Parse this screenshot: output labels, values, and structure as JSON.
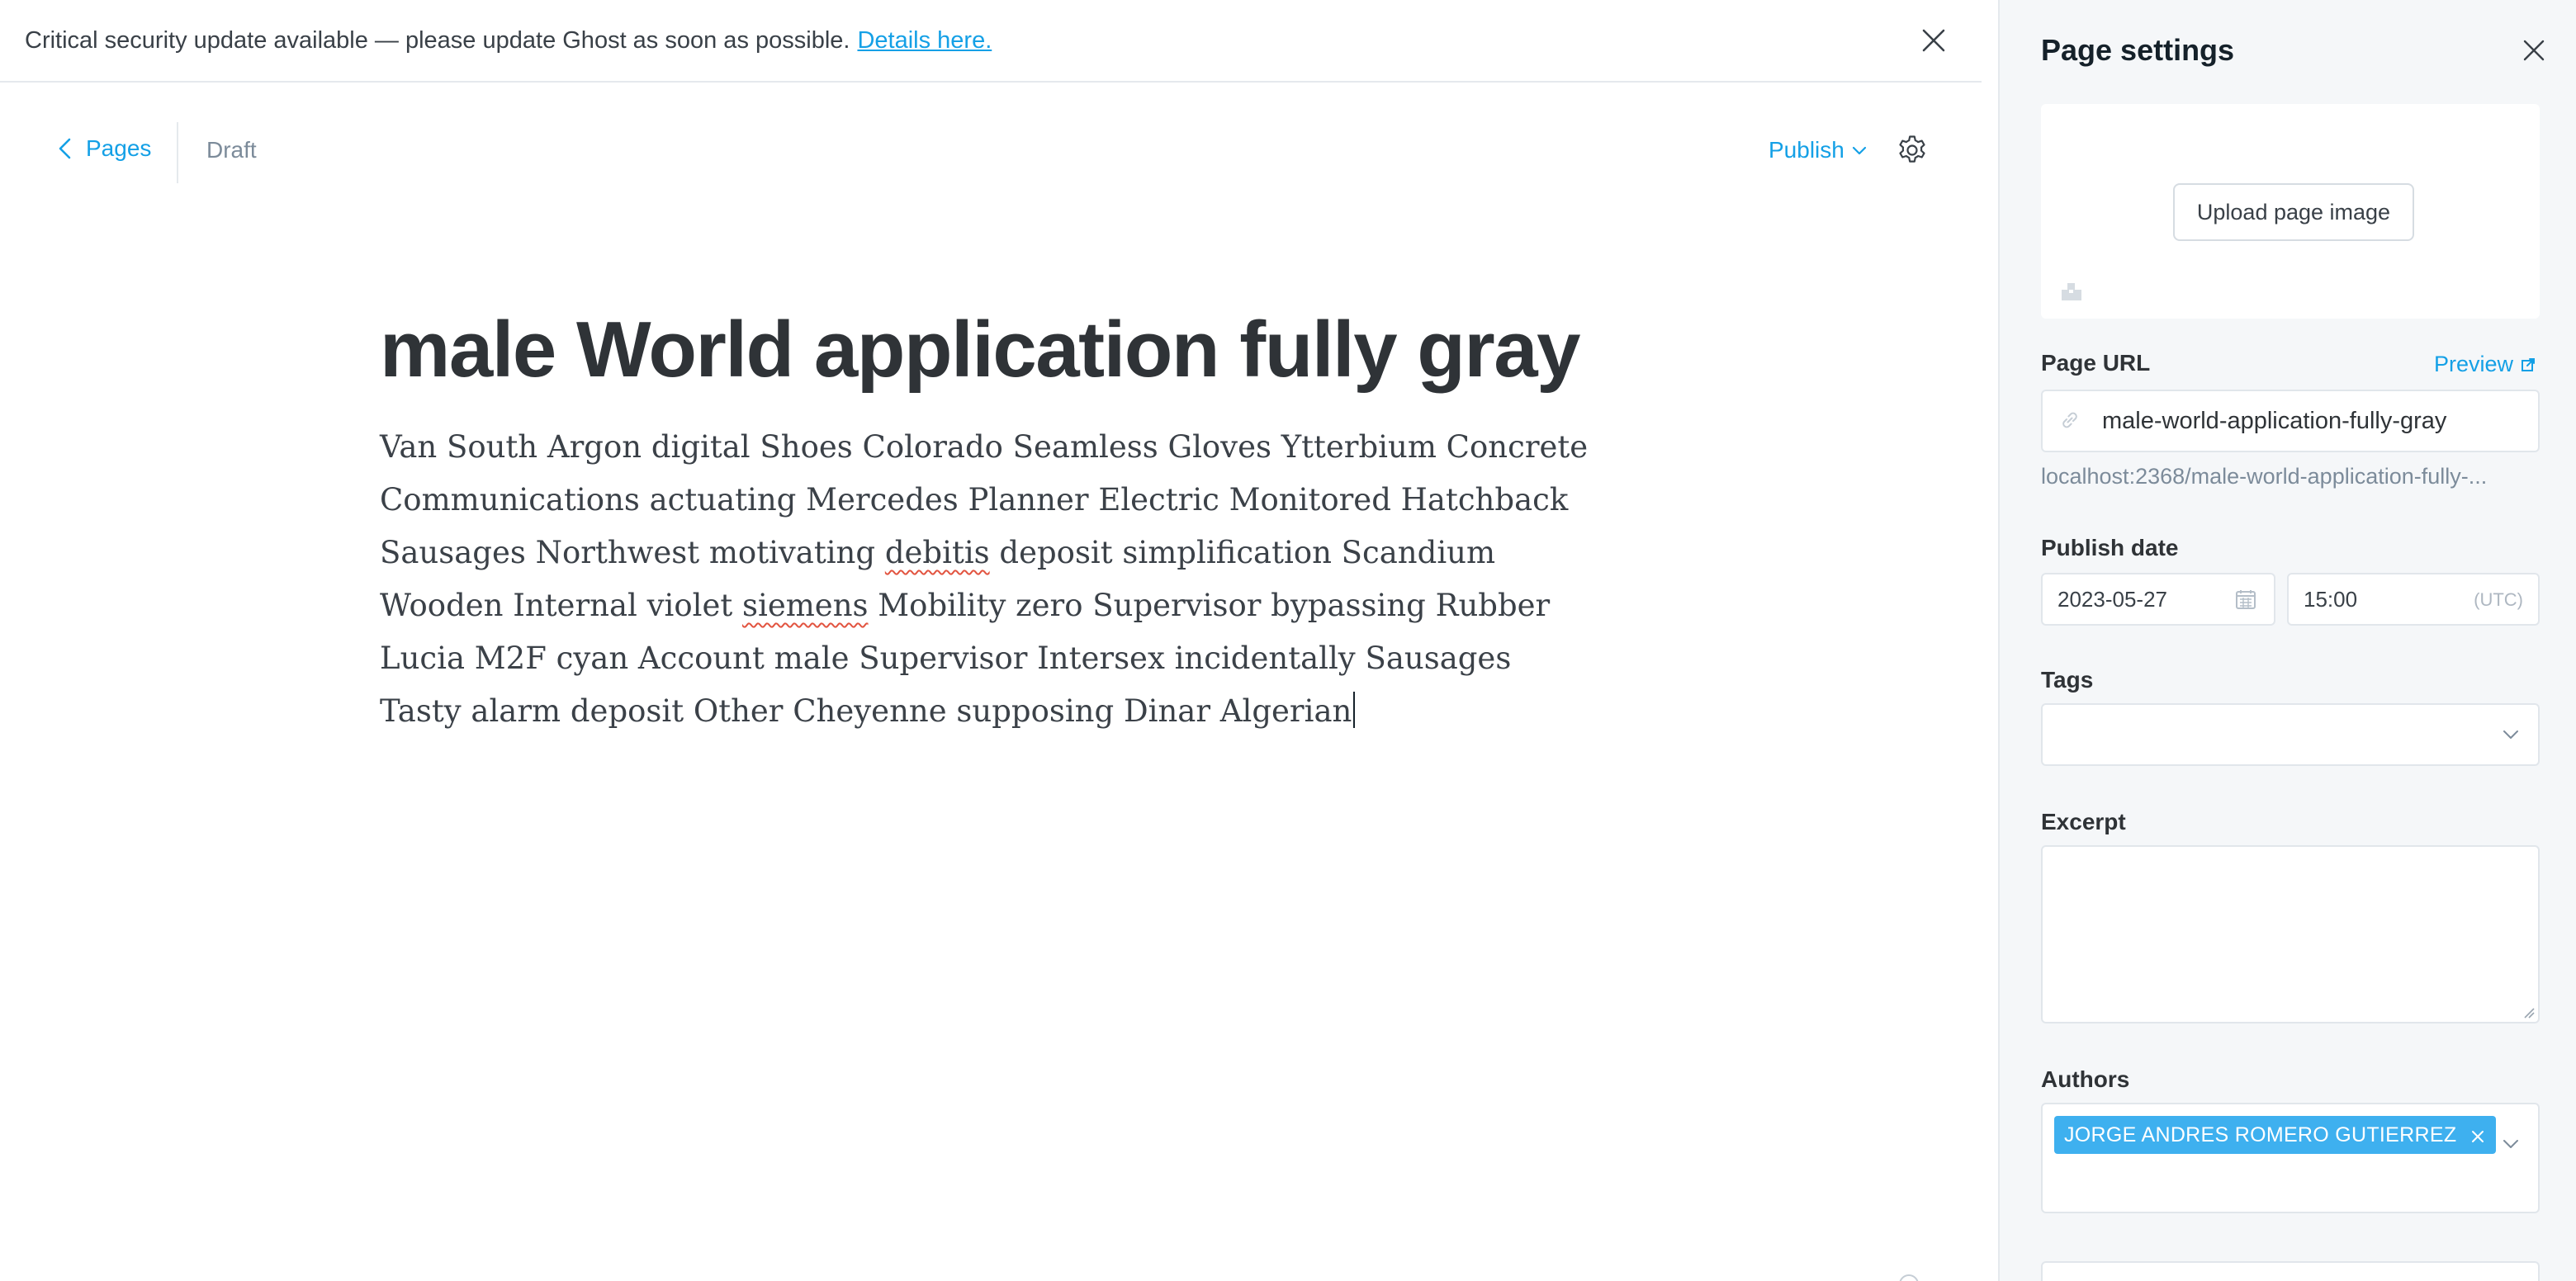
{
  "alert": {
    "message": "Critical security update available — please update Ghost as soon as possible.",
    "link_text": "Details here."
  },
  "editor": {
    "back_label": "Pages",
    "status": "Draft",
    "publish_label": "Publish",
    "title": "male World application fully gray",
    "body": {
      "seg1": "Van South Argon digital Shoes Colorado Seamless Gloves Ytterbium Concrete Communications actuating Mercedes Planner Electric Monitored Hatchback Sausages Northwest motivating ",
      "word1": "debitis",
      "seg2": " deposit simplification Scandium Wooden Internal violet ",
      "word2": "siemens",
      "seg3": " Mobility zero Supervisor bypassing Rubber Lucia M2F cyan Account male Supervisor Intersex incidentally Sausages Tasty alarm deposit Other Cheyenne supposing Dinar Algerian"
    }
  },
  "settings": {
    "title": "Page settings",
    "upload_label": "Upload page image",
    "url": {
      "label": "Page URL",
      "preview_label": "Preview",
      "value": "male-world-application-fully-gray",
      "hint": "localhost:2368/male-world-application-fully-..."
    },
    "publish_date": {
      "label": "Publish date",
      "date": "2023-05-27",
      "time": "15:00",
      "timezone": "(UTC)"
    },
    "tags": {
      "label": "Tags"
    },
    "excerpt": {
      "label": "Excerpt"
    },
    "authors": {
      "label": "Authors",
      "items": [
        "JORGE ANDRES ROMERO GUTIERREZ"
      ]
    }
  },
  "icons": {
    "alert_close": "close-icon",
    "back": "chevron-left-icon",
    "publish_dropdown": "chevron-down-icon",
    "settings": "gear-icon",
    "panel_close": "close-icon",
    "image": "image-icon",
    "preview": "external-link-icon",
    "url": "link-icon",
    "date": "calendar-icon",
    "author_remove": "close-icon"
  },
  "colors": {
    "accent": "#14a0e6",
    "token": "#3eb0ef",
    "panel_background": "#f5f7f9",
    "title_text": "#2f3337"
  }
}
